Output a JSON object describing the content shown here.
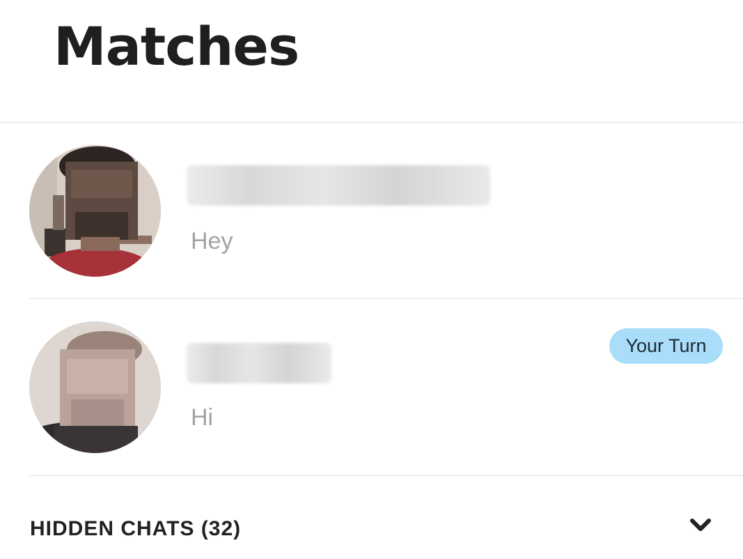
{
  "header": {
    "title": "Matches"
  },
  "matches": [
    {
      "last_message": "Hey",
      "avatar_icon": "profile-photo",
      "name_hidden": true
    },
    {
      "last_message": "Hi",
      "avatar_icon": "profile-photo",
      "name_hidden": true,
      "badge": "Your Turn"
    }
  ],
  "hidden_chats": {
    "label": "HIDDEN CHATS (32)",
    "icon": "chevron-down-icon"
  },
  "colors": {
    "badge_background": "#a9ddfa",
    "message_text": "#a3a3a3",
    "divider": "#dcdcdc"
  }
}
